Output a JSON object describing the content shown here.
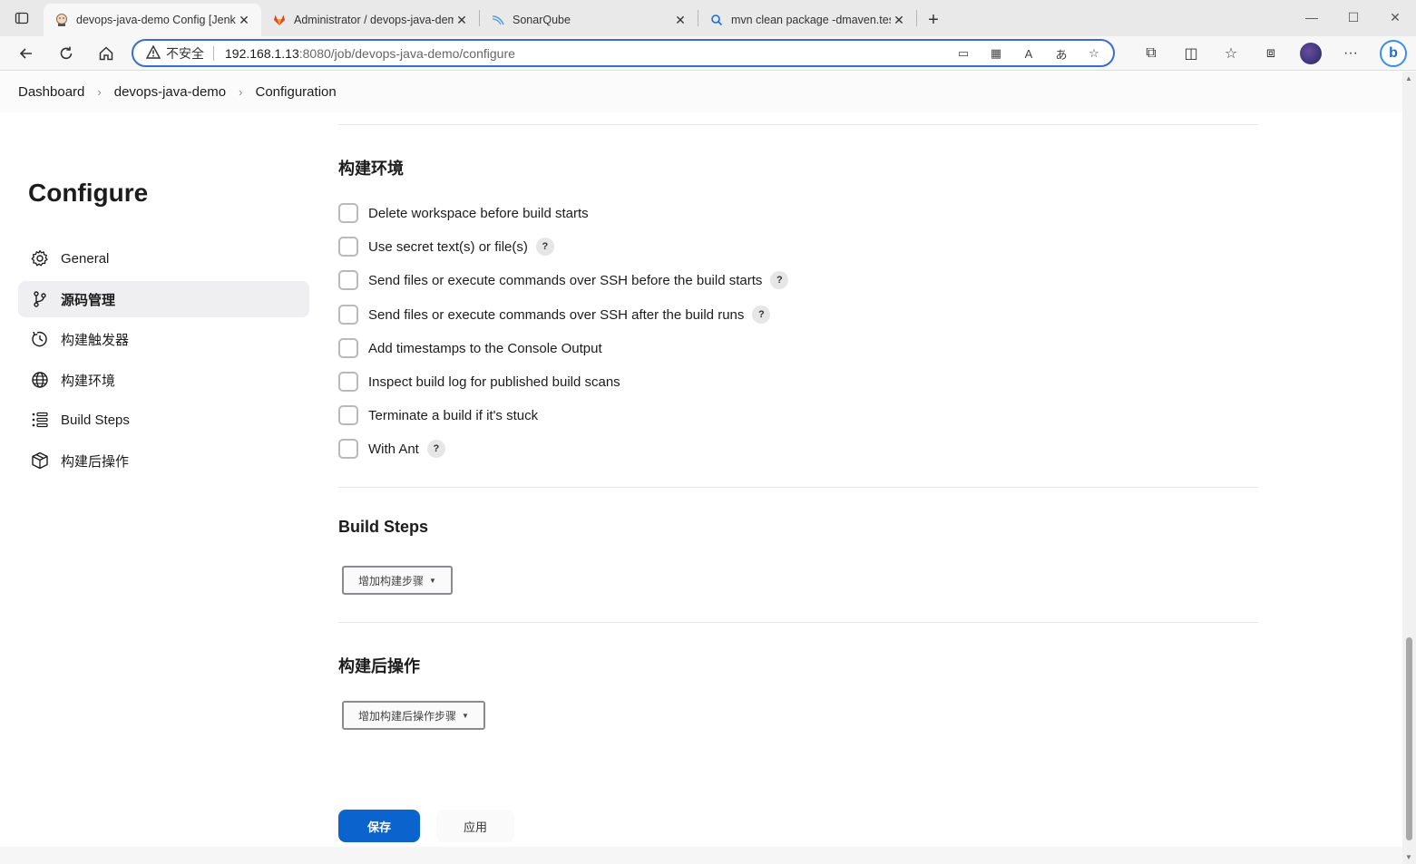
{
  "browser": {
    "tabs": [
      {
        "title": "devops-java-demo Config [Jenkins]",
        "icon": "jenkins-icon",
        "active": true
      },
      {
        "title": "Administrator / devops-java-demo",
        "icon": "gitlab-icon",
        "active": false
      },
      {
        "title": "SonarQube",
        "icon": "sonarqube-icon",
        "active": false
      },
      {
        "title": "mvn clean package -dmaven.test",
        "icon": "search-icon",
        "active": false
      }
    ],
    "address": {
      "insecure_label": "不安全",
      "host": "192.168.1.13",
      "path": ":8080/job/devops-java-demo/configure"
    }
  },
  "breadcrumb": {
    "items": [
      "Dashboard",
      "devops-java-demo",
      "Configuration"
    ]
  },
  "sidebar": {
    "title": "Configure",
    "items": [
      {
        "label": "General",
        "icon": "gear-icon"
      },
      {
        "label": "源码管理",
        "icon": "branch-icon"
      },
      {
        "label": "构建触发器",
        "icon": "clock-icon"
      },
      {
        "label": "构建环境",
        "icon": "globe-icon"
      },
      {
        "label": "Build Steps",
        "icon": "list-icon"
      },
      {
        "label": "构建后操作",
        "icon": "package-icon"
      }
    ]
  },
  "build_env": {
    "heading": "构建环境",
    "options": [
      {
        "label": "Delete workspace before build starts",
        "help": false
      },
      {
        "label": "Use secret text(s) or file(s)",
        "help": true
      },
      {
        "label": "Send files or execute commands over SSH before the build starts",
        "help": true
      },
      {
        "label": "Send files or execute commands over SSH after the build runs",
        "help": true
      },
      {
        "label": "Add timestamps to the Console Output",
        "help": false
      },
      {
        "label": "Inspect build log for published build scans",
        "help": false
      },
      {
        "label": "Terminate a build if it's stuck",
        "help": false
      },
      {
        "label": "With Ant",
        "help": true
      }
    ],
    "help_glyph": "?"
  },
  "build_steps": {
    "heading": "Build Steps",
    "add_button": "增加构建步骤"
  },
  "post_build": {
    "heading": "构建后操作",
    "add_button": "增加构建后操作步骤"
  },
  "actions": {
    "save": "保存",
    "apply": "应用"
  },
  "colors": {
    "primary": "#0b63ce",
    "focus_ring": "#3a6dd1"
  }
}
